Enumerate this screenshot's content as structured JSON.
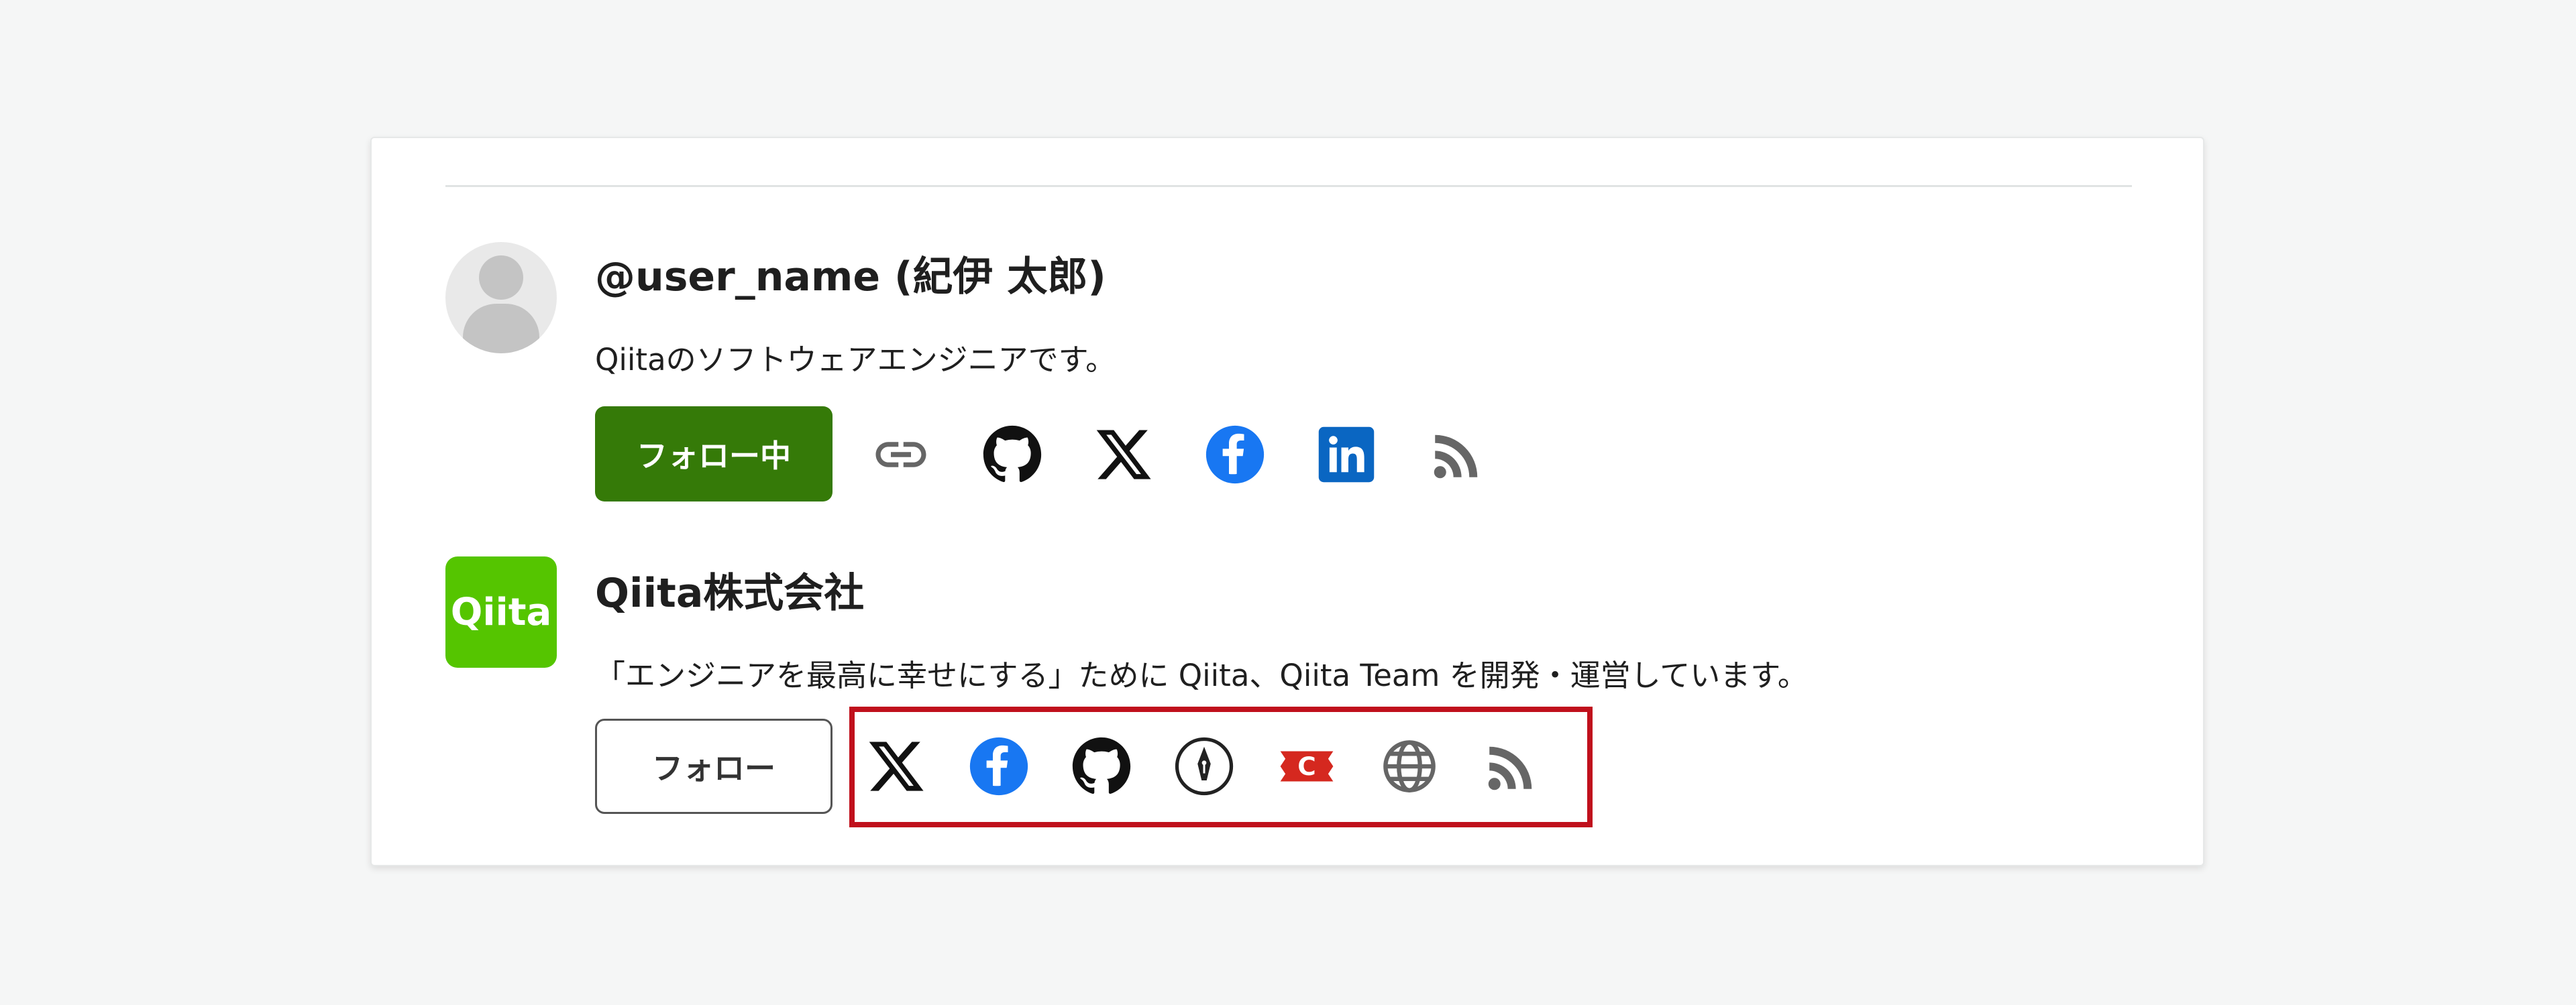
{
  "user": {
    "name": "@user_name (紀伊 太郎)",
    "description": "Qiitaのソフトウェアエンジニアです。",
    "follow_label": "フォロー中",
    "links": [
      {
        "icon": "link-icon"
      },
      {
        "icon": "github-icon"
      },
      {
        "icon": "x-icon"
      },
      {
        "icon": "facebook-icon"
      },
      {
        "icon": "linkedin-icon"
      },
      {
        "icon": "rss-icon"
      }
    ]
  },
  "organization": {
    "logo_text": "Qiita",
    "name": "Qiita株式会社",
    "description": "「エンジニアを最高に幸せにする」ために Qiita、Qiita Team を開発・運営しています。",
    "follow_label": "フォロー",
    "links": [
      {
        "icon": "x-icon"
      },
      {
        "icon": "facebook-icon"
      },
      {
        "icon": "github-icon"
      },
      {
        "icon": "note-pen-icon"
      },
      {
        "icon": "connpass-icon"
      },
      {
        "icon": "globe-icon"
      },
      {
        "icon": "rss-icon"
      }
    ]
  },
  "colors": {
    "follow_active_bg": "#357a08",
    "qiita_green": "#55c500",
    "facebook_blue": "#1877f2",
    "linkedin_blue": "#0a66c2",
    "connpass_red": "#d5281f",
    "highlight_red": "#c0101c"
  }
}
